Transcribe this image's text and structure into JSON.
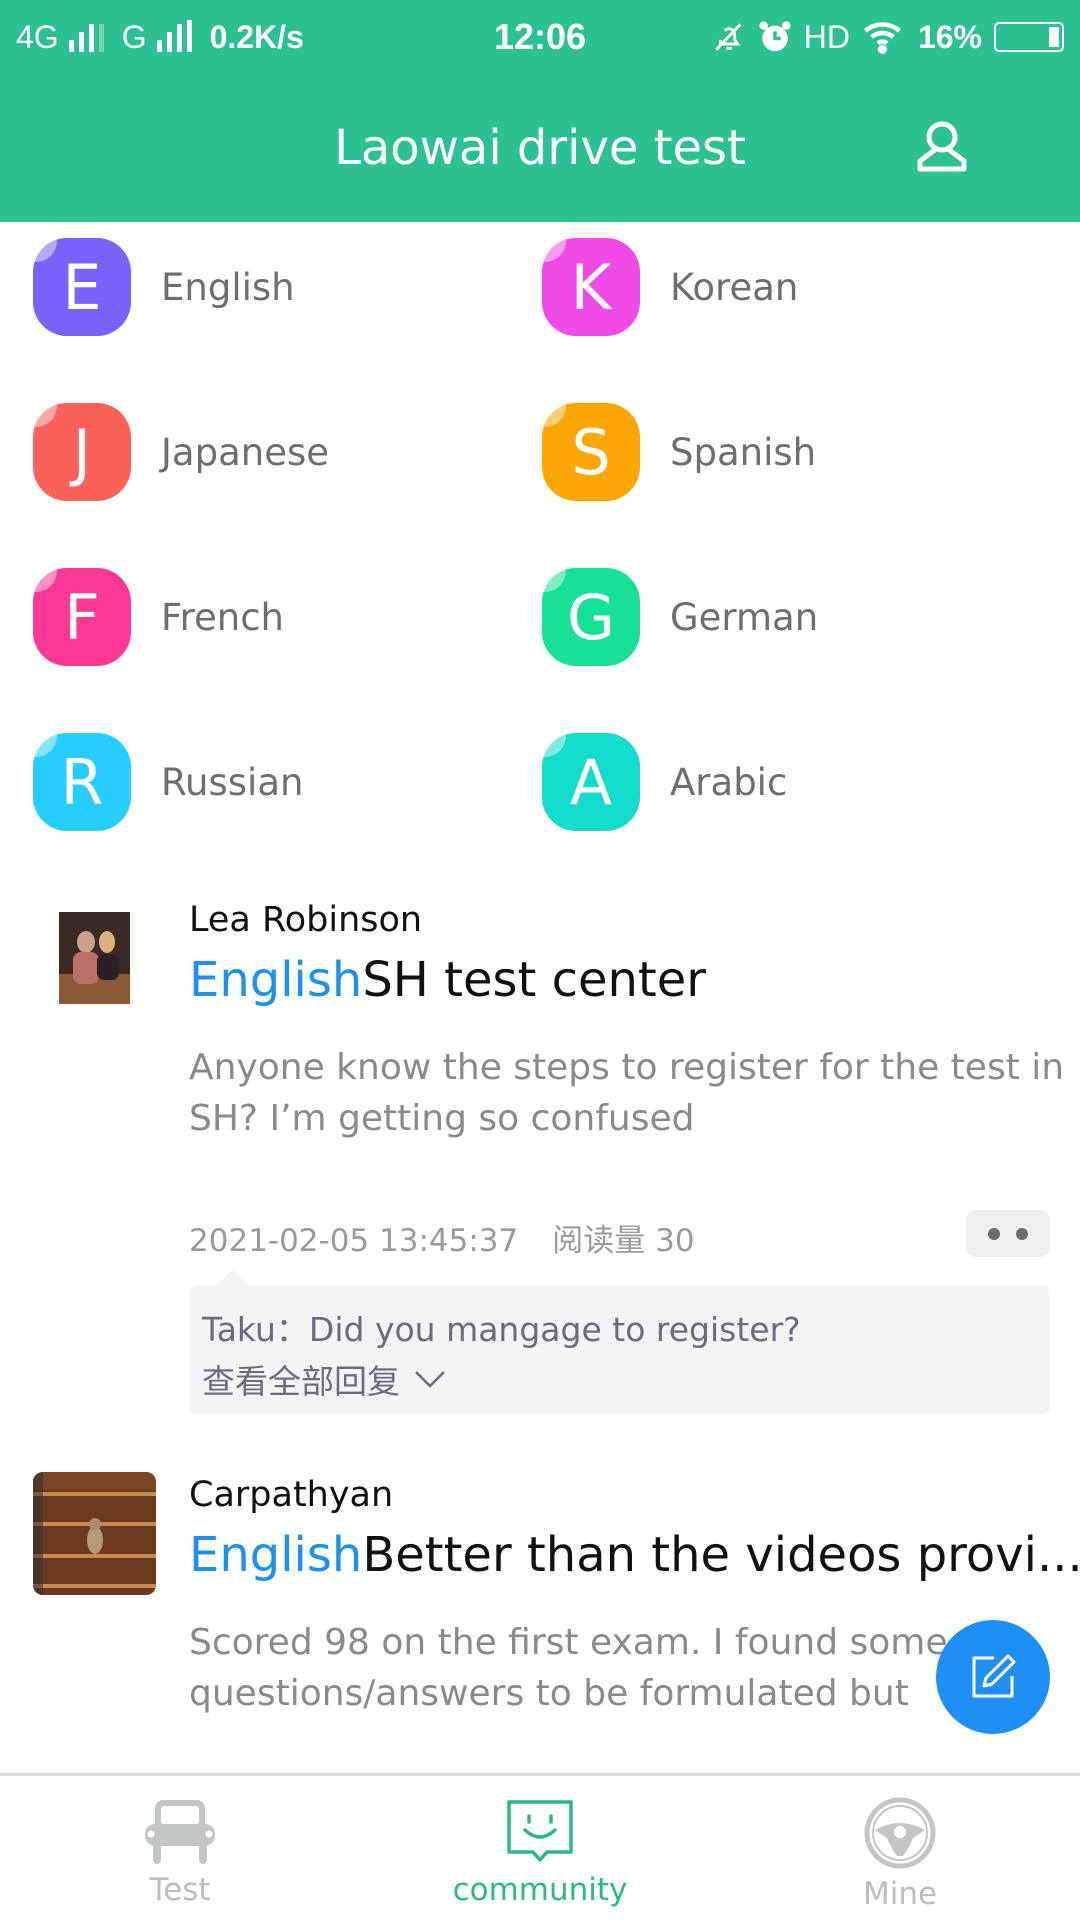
{
  "status_bar": {
    "network1": "4G",
    "network2": "G",
    "speed": "0.2K/s",
    "time": "12:06",
    "hd": "HD",
    "battery": "16%",
    "battery_level": 0.16
  },
  "header": {
    "title": "Laowai drive test",
    "profile_icon": "user-icon",
    "background": "#2cc191"
  },
  "languages": [
    {
      "letter": "E",
      "label": "English",
      "color": "#7a62fb"
    },
    {
      "letter": "K",
      "label": "Korean",
      "color": "#f04be6"
    },
    {
      "letter": "J",
      "label": "Japanese",
      "color": "#fb625a"
    },
    {
      "letter": "S",
      "label": "Spanish",
      "color": "#fda604"
    },
    {
      "letter": "F",
      "label": "French",
      "color": "#fb3894"
    },
    {
      "letter": "G",
      "label": "German",
      "color": "#16e196"
    },
    {
      "letter": "R",
      "label": "Russian",
      "color": "#26cefd"
    },
    {
      "letter": "A",
      "label": "Arabic",
      "color": "#14dccb"
    }
  ],
  "posts": [
    {
      "author": "Lea Robinson",
      "tag": "English",
      "title": "SH test center",
      "body": "Anyone know the steps to register for the test in SH? I’m getting so confused",
      "timestamp": "2021-02-05 13:45:37",
      "views_label": "阅读量 30",
      "reply": "Taku：Did you mangage to register?",
      "view_all_replies": "查看全部回复"
    },
    {
      "author": "Carpathyan",
      "tag": "English",
      "title": "Better than the videos provi...",
      "body": "Scored 98 on the first exam. I found some questions/answers to be formulated but ov"
    }
  ],
  "fab": {
    "icon": "edit-icon",
    "color": "#1e90f5"
  },
  "bottom_nav": {
    "items": [
      {
        "label": "Test",
        "icon": "car-icon",
        "active": false
      },
      {
        "label": "community",
        "icon": "chat-smile-icon",
        "active": true
      },
      {
        "label": "Mine",
        "icon": "steering-wheel-icon",
        "active": false
      }
    ],
    "active_color": "#2cb98a",
    "inactive_color": "#bdbdbd"
  }
}
